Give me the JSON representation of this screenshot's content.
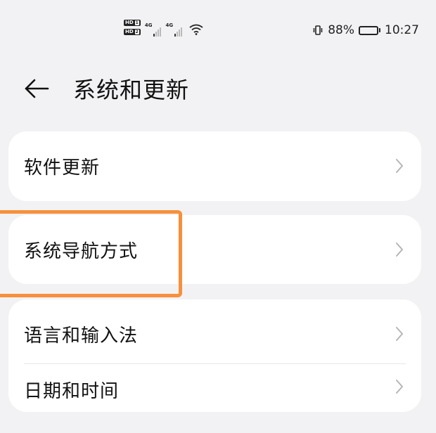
{
  "status_bar": {
    "network_1": "4G",
    "network_2": "4G",
    "battery": "88%",
    "battery_level": 0.88,
    "time": "10:27",
    "sim_badges": [
      {
        "label": "HD",
        "num": "1"
      },
      {
        "label": "HD",
        "num": "2"
      }
    ]
  },
  "header": {
    "title": "系统和更新"
  },
  "menu": {
    "items": [
      {
        "label": "软件更新"
      },
      {
        "label": "系统导航方式"
      },
      {
        "label": "语言和输入法"
      },
      {
        "label": "日期和时间"
      }
    ]
  },
  "colors": {
    "highlight": "#f7903b",
    "background": "#f2f2f4",
    "card": "#ffffff"
  },
  "icons": {
    "back": "arrow-left-icon",
    "chevron": "chevron-right-icon",
    "wifi": "wifi-icon",
    "vibrate": "vibrate-icon",
    "battery": "battery-icon"
  }
}
